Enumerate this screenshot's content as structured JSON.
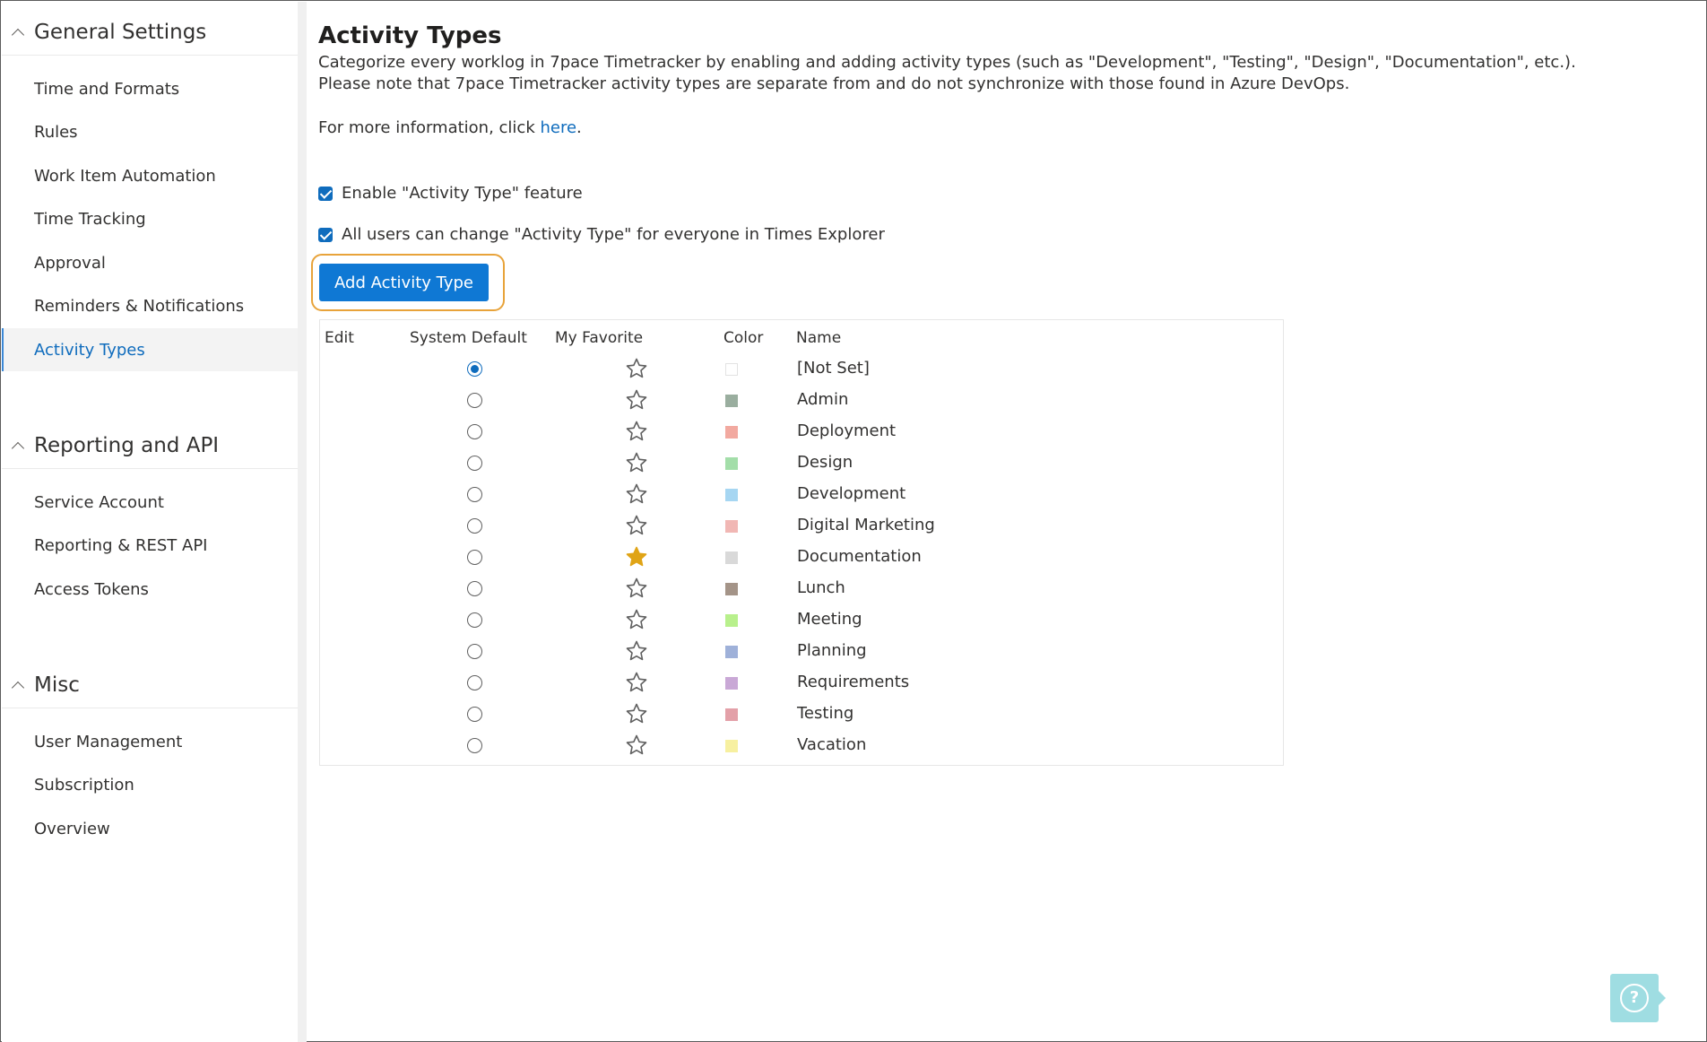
{
  "sidebar": {
    "sections": [
      {
        "title": "General Settings",
        "items": [
          {
            "label": "Time and Formats"
          },
          {
            "label": "Rules"
          },
          {
            "label": "Work Item Automation"
          },
          {
            "label": "Time Tracking"
          },
          {
            "label": "Approval"
          },
          {
            "label": "Reminders & Notifications"
          },
          {
            "label": "Activity Types",
            "active": true
          }
        ]
      },
      {
        "title": "Reporting and API",
        "items": [
          {
            "label": "Service Account"
          },
          {
            "label": "Reporting & REST API"
          },
          {
            "label": "Access Tokens"
          }
        ]
      },
      {
        "title": "Misc",
        "items": [
          {
            "label": "User Management"
          },
          {
            "label": "Subscription"
          },
          {
            "label": "Overview"
          }
        ]
      }
    ]
  },
  "main": {
    "title": "Activity Types",
    "description_line1": "Categorize every worklog in 7pace Timetracker by enabling and adding activity types (such as \"Development\", \"Testing\", \"Design\", \"Documentation\", etc.).",
    "description_line2": "Please note that 7pace Timetracker activity types are separate from and do not synchronize with those found in Azure DevOps.",
    "more_info_prefix": "For more information, click ",
    "more_info_link": "here",
    "more_info_suffix": ".",
    "checkbox_enable": "Enable \"Activity Type\" feature",
    "checkbox_all_users": "All users can change \"Activity Type\" for everyone in Times Explorer",
    "add_button": "Add Activity Type"
  },
  "table": {
    "columns": [
      "Edit",
      "System Default",
      "My Favorite",
      "Color",
      "Name"
    ],
    "rows": [
      {
        "name": "[Not Set]",
        "default": true,
        "favorite": false,
        "color": "#ffffff"
      },
      {
        "name": "Admin",
        "default": false,
        "favorite": false,
        "color": "#9aae9f"
      },
      {
        "name": "Deployment",
        "default": false,
        "favorite": false,
        "color": "#f2a9a0"
      },
      {
        "name": "Design",
        "default": false,
        "favorite": false,
        "color": "#a3dea9"
      },
      {
        "name": "Development",
        "default": false,
        "favorite": false,
        "color": "#a6d6f2"
      },
      {
        "name": "Digital Marketing",
        "default": false,
        "favorite": false,
        "color": "#f1b7b4"
      },
      {
        "name": "Documentation",
        "default": false,
        "favorite": true,
        "color": "#d9d9d9"
      },
      {
        "name": "Lunch",
        "default": false,
        "favorite": false,
        "color": "#a49488"
      },
      {
        "name": "Meeting",
        "default": false,
        "favorite": false,
        "color": "#b8f08c"
      },
      {
        "name": "Planning",
        "default": false,
        "favorite": false,
        "color": "#9fb1d9"
      },
      {
        "name": "Requirements",
        "default": false,
        "favorite": false,
        "color": "#c9a8d6"
      },
      {
        "name": "Testing",
        "default": false,
        "favorite": false,
        "color": "#e3a0a8"
      },
      {
        "name": "Vacation",
        "default": false,
        "favorite": false,
        "color": "#f7f0a0"
      }
    ]
  },
  "colors": {
    "accent": "#0f78d4",
    "link": "#0f6cbd",
    "highlight": "#e8a33a",
    "favorite_star": "#e0a416",
    "help_widget": "#9fdde2"
  },
  "help": {
    "icon": "question-icon"
  }
}
